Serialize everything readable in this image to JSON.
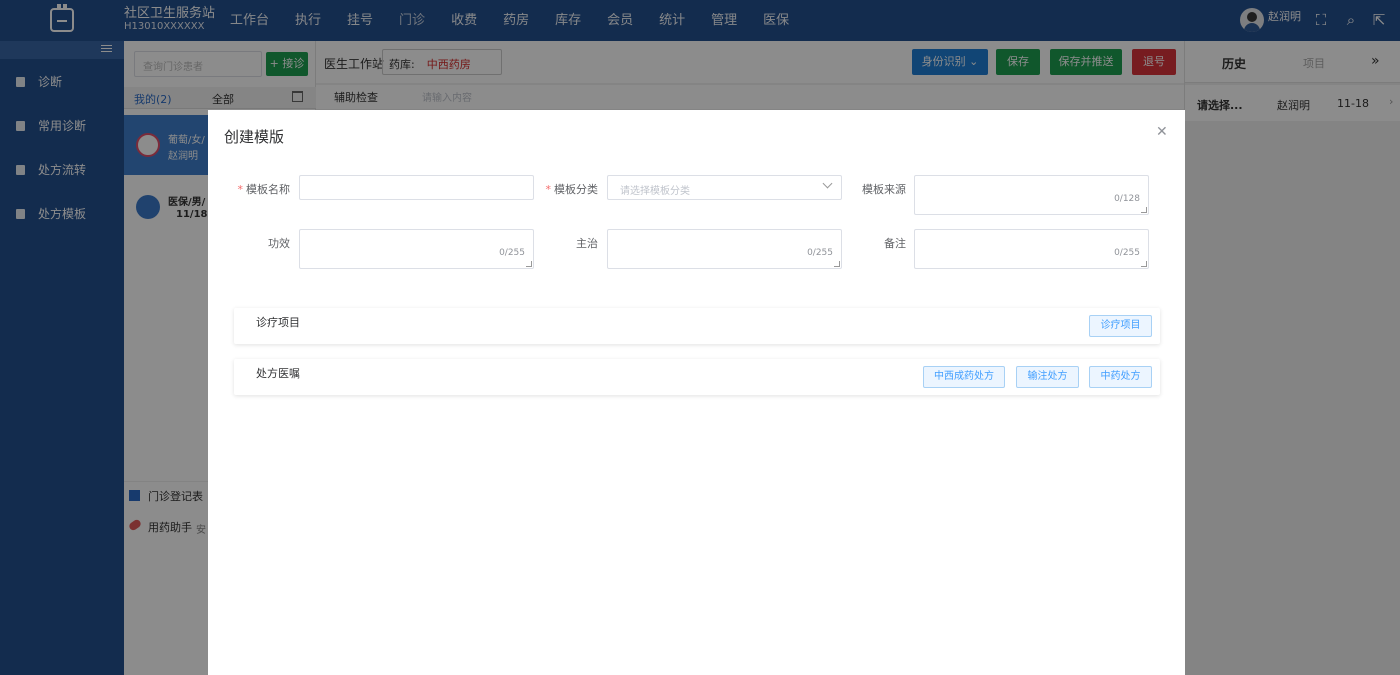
{
  "app": {
    "name": "社区卫生服务站",
    "code": "H13010XXXXXX"
  },
  "topnav": [
    "工作台",
    "执行",
    "挂号",
    "门诊",
    "收费",
    "药房",
    "库存",
    "会员",
    "统计",
    "管理",
    "医保"
  ],
  "user": {
    "name": "赵润明"
  },
  "sidebar": {
    "items": [
      {
        "label": "诊断",
        "icon": "diagnosis-icon"
      },
      {
        "label": "常用诊断",
        "icon": "common-diagnosis-icon"
      },
      {
        "label": "处方流转",
        "icon": "prescription-transfer-icon"
      },
      {
        "label": "处方模板",
        "icon": "prescription-template-icon"
      }
    ]
  },
  "patients": {
    "search_placeholder": "查询门诊患者",
    "admit_label": "+ 接诊",
    "tabs": {
      "mine": "我的(2)",
      "all": "全部"
    },
    "list": [
      {
        "line1": "葡萄/女/",
        "line2": "赵润明"
      },
      {
        "line1": "医保/男/",
        "line2": "11/18"
      }
    ],
    "bottom": {
      "register": "门诊登记表",
      "assistant": "用药助手",
      "assistant_extra": "安"
    }
  },
  "workstation": {
    "title": "医生工作站",
    "pharmacy_label": "药库:",
    "pharmacy_value": "中西药房",
    "buttons": {
      "identify": "身份识别",
      "save": "保存",
      "save_push": "保存并推送",
      "refund": "退号"
    },
    "assist_label": "辅助检查",
    "assist_placeholder": "请输入内容",
    "colors": {
      "identify": "#1f7fd6",
      "save": "#1e9e51",
      "refund": "#d9333b"
    }
  },
  "right_panel": {
    "tabs": {
      "history": "历史",
      "items": "项目"
    },
    "row": {
      "select": "请选择...",
      "doctor": "赵润明",
      "date": "11-18"
    }
  },
  "modal": {
    "title": "创建模版",
    "fields": {
      "name_label": "模板名称",
      "category_label": "模板分类",
      "category_placeholder": "请选择模板分类",
      "source_label": "模板来源",
      "source_count": "0/128",
      "effect_label": "功效",
      "effect_count": "0/255",
      "indication_label": "主治",
      "indication_count": "0/255",
      "remark_label": "备注",
      "remark_count": "0/255"
    },
    "sections": {
      "treatment": {
        "title": "诊疗项目",
        "buttons": [
          "诊疗项目"
        ]
      },
      "prescription": {
        "title": "处方医嘱",
        "buttons": [
          "中西成药处方",
          "输注处方",
          "中药处方"
        ]
      }
    }
  }
}
